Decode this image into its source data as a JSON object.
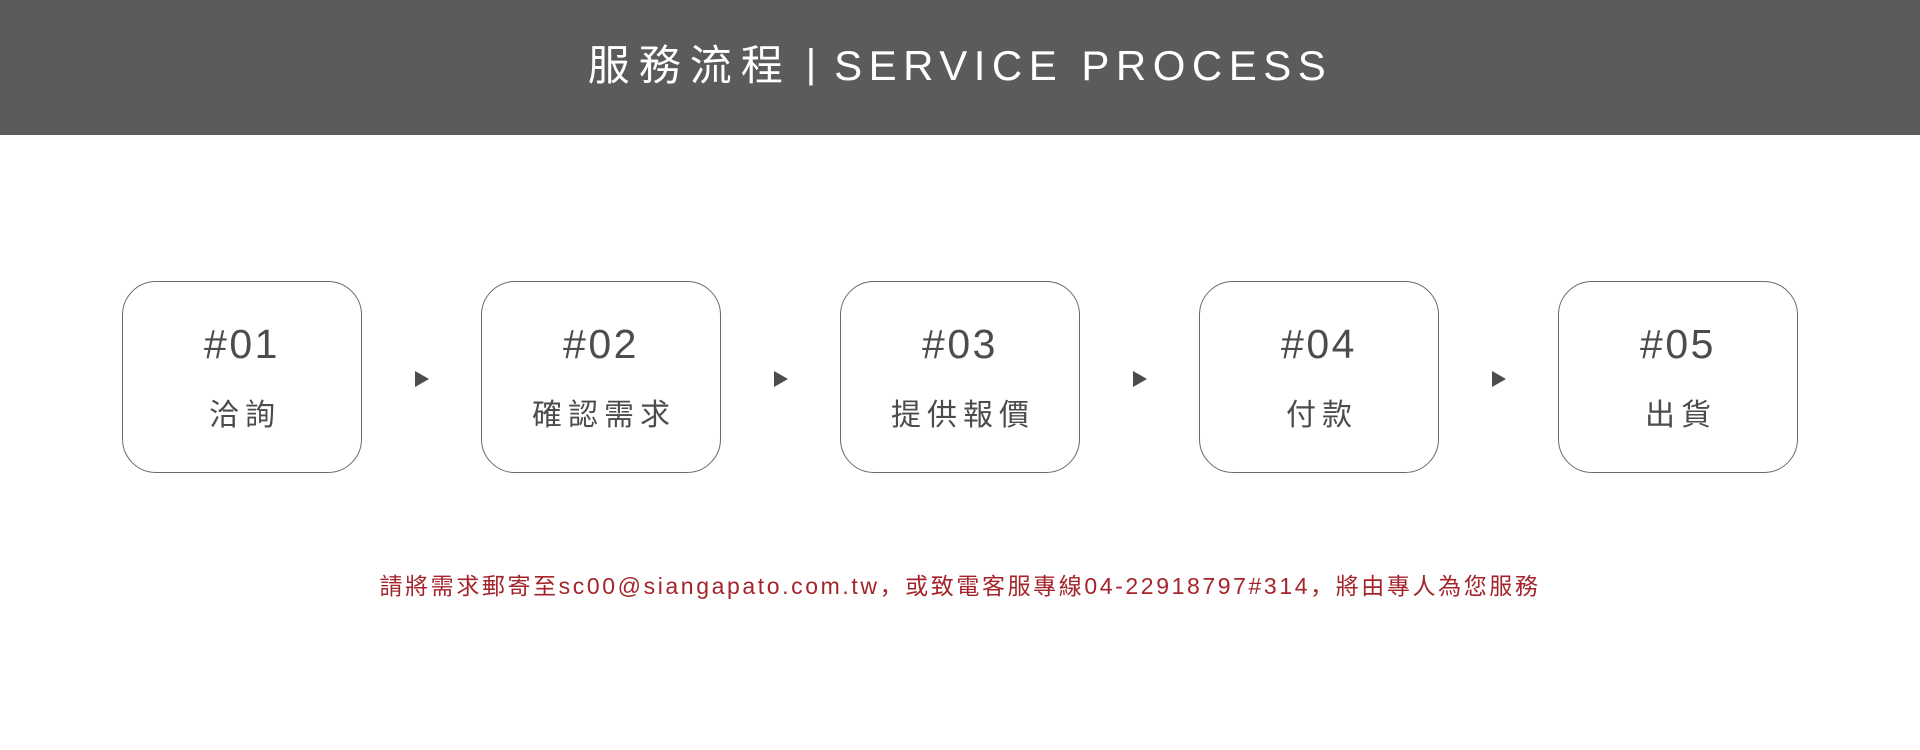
{
  "header": {
    "title_cn": "服務流程",
    "separator": "|",
    "title_en": "SERVICE PROCESS",
    "background_color": "#5b5b5b",
    "text_color": "#ffffff"
  },
  "process": {
    "arrow_glyph": "▶",
    "border_color": "#6a6a6a",
    "text_color": "#4c4c4c",
    "steps": [
      {
        "number": "#01",
        "label": "洽詢"
      },
      {
        "number": "#02",
        "label": "確認需求"
      },
      {
        "number": "#03",
        "label": "提供報價"
      },
      {
        "number": "#04",
        "label": "付款"
      },
      {
        "number": "#05",
        "label": "出貨"
      }
    ]
  },
  "footer": {
    "note": "請將需求郵寄至sc00@siangapato.com.tw，或致電客服專線04-22918797#314，將由專人為您服務",
    "color": "#a3252b"
  }
}
